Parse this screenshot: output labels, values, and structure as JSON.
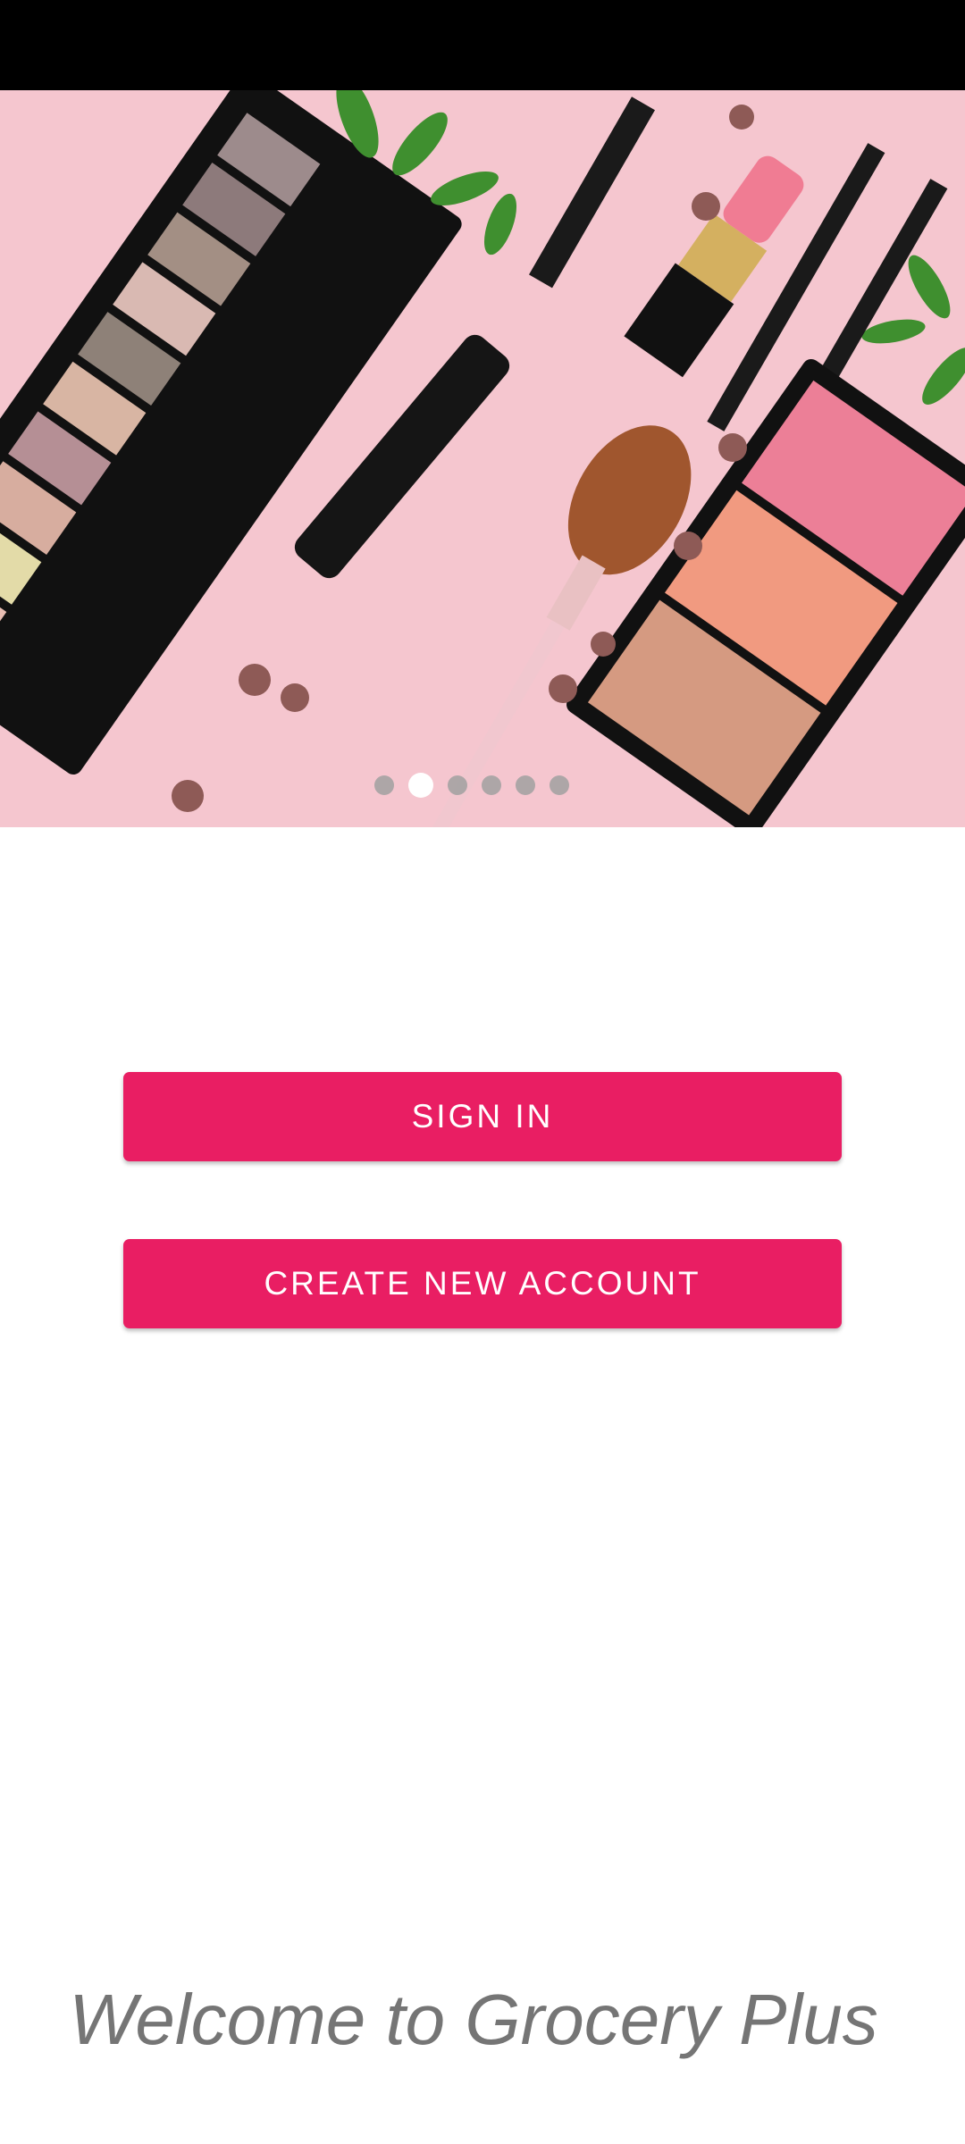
{
  "colors": {
    "primary": "#E91E63",
    "status_bar": "#000000",
    "welcome_text": "#757575"
  },
  "hero": {
    "image_name": "makeup-flatlay-image",
    "carousel": {
      "total": 6,
      "active_index": 1
    }
  },
  "actions": {
    "sign_in_label": "SIGN IN",
    "create_account_label": "CREATE NEW ACCOUNT"
  },
  "welcome": {
    "text": "Welcome to Grocery Plus"
  }
}
